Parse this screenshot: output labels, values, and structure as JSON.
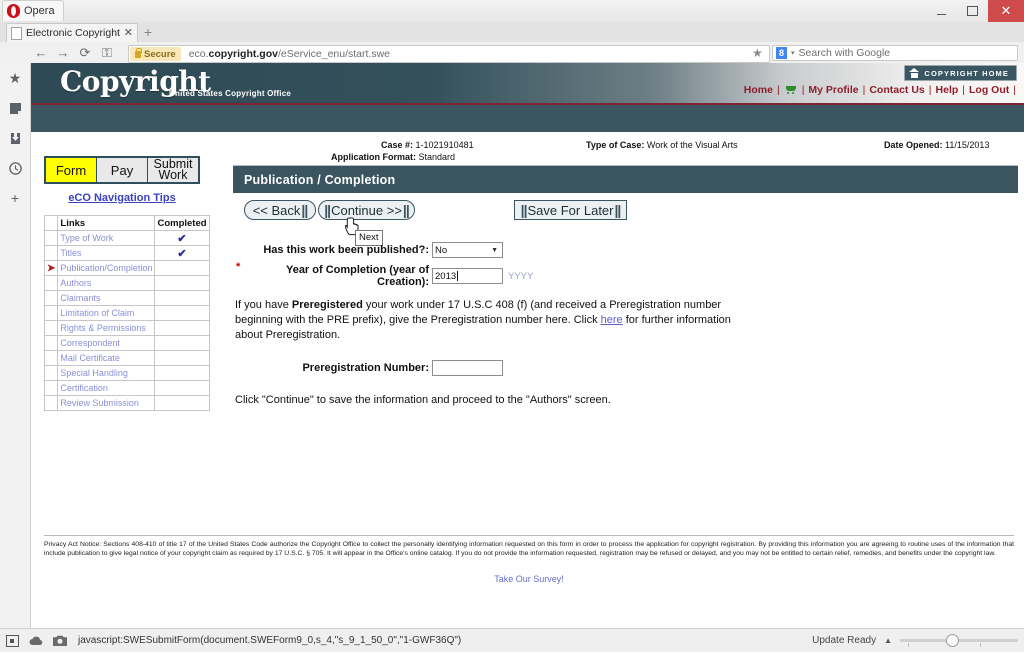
{
  "window": {
    "opera_label": "Opera",
    "minimize": "—",
    "maximize": "□",
    "close": "✕"
  },
  "browser": {
    "tab": {
      "title": "Electronic Copyright O...",
      "close": "✕",
      "favicon": "page-icon"
    },
    "new_tab": "+",
    "nav": {
      "back": "←",
      "forward": "→",
      "reload": "⟳",
      "key": "⚿"
    },
    "address": {
      "secure_label": "Secure",
      "url_prefix": "eco.",
      "url_bold": "copyright.gov",
      "url_suffix": "/eService_enu/start.swe"
    },
    "bookmark_star": "★",
    "search": {
      "engine_letter": "8",
      "caret": "▾",
      "placeholder": "Search with Google"
    },
    "sidebar_icons": [
      "star-icon",
      "news-icon",
      "downloads-icon",
      "history-icon",
      "plus-icon"
    ]
  },
  "site_header": {
    "logo_text": "Copyright",
    "logo_subtitle": "United States Copyright Office",
    "home_chip": "COPYRIGHT HOME",
    "links": [
      "Home",
      "My Profile",
      "Contact Us",
      "Help",
      "Log Out"
    ],
    "separator": "|",
    "cart_icon": "shopping-cart-icon"
  },
  "case_info": {
    "case_label": "Case #:",
    "case_value": "1-1021910481",
    "format_label": "Application Format:",
    "format_value": "Standard",
    "type_label": "Type of Case:",
    "type_value": "Work of the Visual Arts",
    "date_label": "Date Opened:",
    "date_value": "11/15/2013"
  },
  "step_tabs": [
    {
      "label": "Form",
      "active": true
    },
    {
      "label": "Pay",
      "active": false
    },
    {
      "label": "Submit Work",
      "active": false
    }
  ],
  "nav_tips": "eCO Navigation Tips",
  "links_table": {
    "header_links": "Links",
    "header_completed": "Completed",
    "check": "✔",
    "current_marker": "➤",
    "rows": [
      {
        "label": "Type of Work",
        "completed": true,
        "current": false
      },
      {
        "label": "Titles",
        "completed": true,
        "current": false
      },
      {
        "label": "Publication/Completion",
        "completed": false,
        "current": true
      },
      {
        "label": "Authors",
        "completed": false,
        "current": false
      },
      {
        "label": "Claimants",
        "completed": false,
        "current": false
      },
      {
        "label": "Limitation of Claim",
        "completed": false,
        "current": false
      },
      {
        "label": "Rights & Permissions",
        "completed": false,
        "current": false
      },
      {
        "label": "Correspondent",
        "completed": false,
        "current": false
      },
      {
        "label": "Mail Certificate",
        "completed": false,
        "current": false
      },
      {
        "label": "Special Handling",
        "completed": false,
        "current": false
      },
      {
        "label": "Certification",
        "completed": false,
        "current": false
      },
      {
        "label": "Review Submission",
        "completed": false,
        "current": false
      }
    ]
  },
  "section": {
    "title": "Publication / Completion"
  },
  "buttons": {
    "back": "<< Back",
    "continue": "Continue >>",
    "save_for_later": "Save For Later",
    "bars": "||"
  },
  "tooltip": {
    "text": "Next"
  },
  "form": {
    "published_label": "Has this work been published?:",
    "published_value": "No",
    "year_required": "*",
    "year_label": "Year of Completion (year of Creation):",
    "year_value": "2013",
    "year_hint": "YYYY",
    "prereg_para_1": "If you have ",
    "prereg_bold": "Preregistered",
    "prereg_para_2": " your work under 17 U.S.C 408 (f) (and received a Preregistration number beginning with the PRE prefix), give the Preregistration number here. Click ",
    "prereg_link": "here",
    "prereg_para_3": " for further information about Preregistration.",
    "prereg_number_label": "Preregistration Number:",
    "prereg_number_value": "",
    "continue_note": "Click \"Continue\" to save the information and proceed to the \"Authors\" screen."
  },
  "footer": {
    "privacy_notice": "Privacy Act Notice: Sections 408-410 of title 17 of the United States Code authorize the Copyright Office to collect the personally identifying information requested on this form in order to process the application for copyright registration. By providing this information you are agreeing to routine uses of the information that include publication to give legal notice of your copyright claim as required by 17 U.S.C. § 705. It will appear in the Office's online catalog. If you do not provide the information requested, registration may be refused or delayed, and you may not be entitled to certain relief, remedies, and benefits under the copyright law.",
    "survey_link": "Take Our Survey!"
  },
  "status_bar": {
    "javascript_url": "javascript:SWESubmitForm(document.SWEForm9_0,s_4,\"s_9_1_50_0\",\"1-GWF36Q\")",
    "update_ready": "Update Ready",
    "up_caret": "▲"
  }
}
